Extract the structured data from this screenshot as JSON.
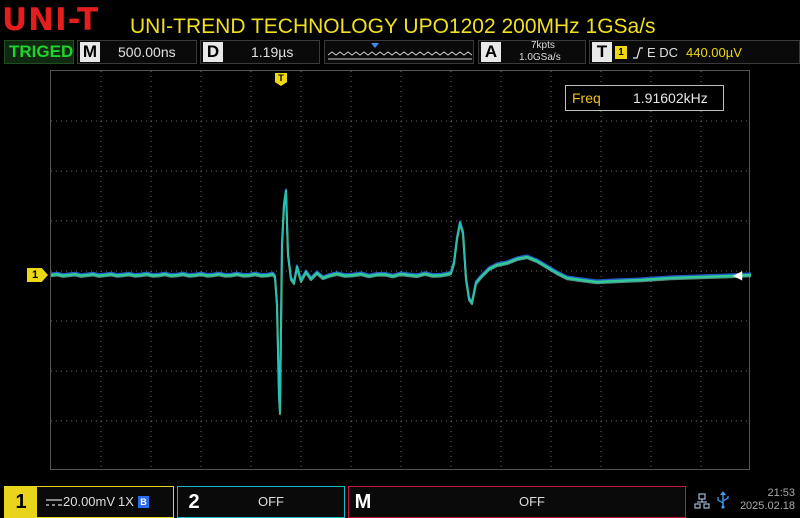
{
  "header": {
    "logo": "UNI-T",
    "title": "UNI-TREND TECHNOLOGY UPO1202 200MHz 1GSa/s"
  },
  "status": {
    "trigger_state": "TRIGED",
    "timebase_label": "M",
    "timebase_value": "500.00ns",
    "delay_label": "D",
    "delay_value": "1.19µs",
    "acq_label": "A",
    "acq_points": "7kpts",
    "acq_rate": "1.0GSa/s",
    "trig_label": "T",
    "trig_source": "1",
    "trig_slope_icon": "rising-edge-icon",
    "trig_mode": "E DC",
    "trig_level": "440.00µV"
  },
  "measure": {
    "freq_label": "Freq",
    "freq_value": "1.91602kHz"
  },
  "markers": {
    "trigger_pos": "T",
    "ch1": "1"
  },
  "channels": {
    "ch1": {
      "num": "1",
      "coupling_icon": "dc-coupling-icon",
      "scale": "20.00mV",
      "probe": "1X",
      "bw_badge": "B"
    },
    "ch2": {
      "num": "2",
      "state": "OFF"
    },
    "math": {
      "num": "M",
      "state": "OFF"
    }
  },
  "clock": {
    "time": "21:53",
    "date": "2025.02.18"
  },
  "colors": {
    "ch1": "#e8d41a",
    "ch2": "#19b8c8",
    "math": "#c0163a",
    "trace_persist": "#2fd38a",
    "trace_blue": "#2a6cf0"
  }
}
